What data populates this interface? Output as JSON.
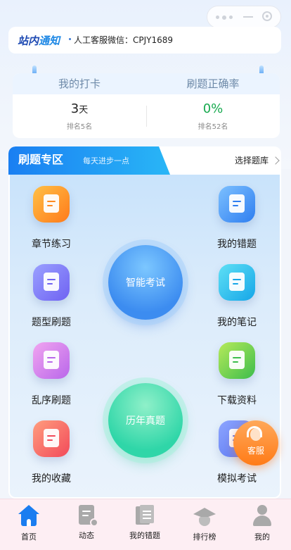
{
  "notice": {
    "logo_part1": "站内",
    "logo_part2": "通知",
    "text": "人工客服微信：CPJY1689"
  },
  "stats": {
    "left": {
      "title": "我的打卡",
      "value": "3",
      "unit": "天",
      "rank": "排名5名"
    },
    "right": {
      "title": "刷题正确率",
      "value": "0%",
      "rank": "排名52名"
    }
  },
  "zone": {
    "title": "刷题专区",
    "subtitle": "每天进步一点",
    "choose": "选择题库",
    "left_items": [
      "章节练习",
      "题型刷题",
      "乱序刷题",
      "我的收藏"
    ],
    "right_items": [
      "我的错题",
      "我的笔记",
      "下载资料",
      "模拟考试"
    ],
    "circle_top": "智能考试",
    "circle_bottom": "历年真题"
  },
  "service": {
    "label": "客服"
  },
  "tabbar": {
    "tabs": [
      "首页",
      "动态",
      "我的错题",
      "排行榜",
      "我的"
    ],
    "active": 0
  },
  "colors": {
    "accent": "#1a7df0",
    "correct_rate": "#16a94e",
    "service": "#ff7b17"
  }
}
